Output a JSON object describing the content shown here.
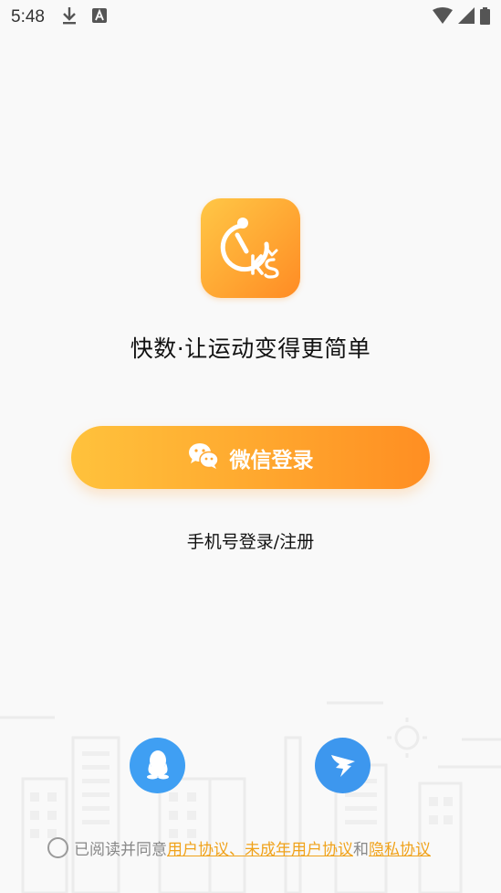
{
  "status_bar": {
    "time": "5:48"
  },
  "app": {
    "slogan": "快数·让运动变得更简单"
  },
  "login": {
    "wechat_label": "微信登录",
    "phone_label": "手机号登录/注册"
  },
  "agreement": {
    "prefix": "已阅读并同意",
    "user_agreement": "用户协议、未成年用户协议",
    "conjunction": "和",
    "privacy_agreement": "隐私协议"
  },
  "colors": {
    "accent": "#ffa32f",
    "link": "#f0a21a",
    "social_blue": "#3f9ff3"
  },
  "icons": [
    "download-icon",
    "a11y-icon",
    "wifi-icon",
    "signal-icon",
    "battery-icon",
    "wechat-icon",
    "qq-icon",
    "dingtalk-icon"
  ]
}
